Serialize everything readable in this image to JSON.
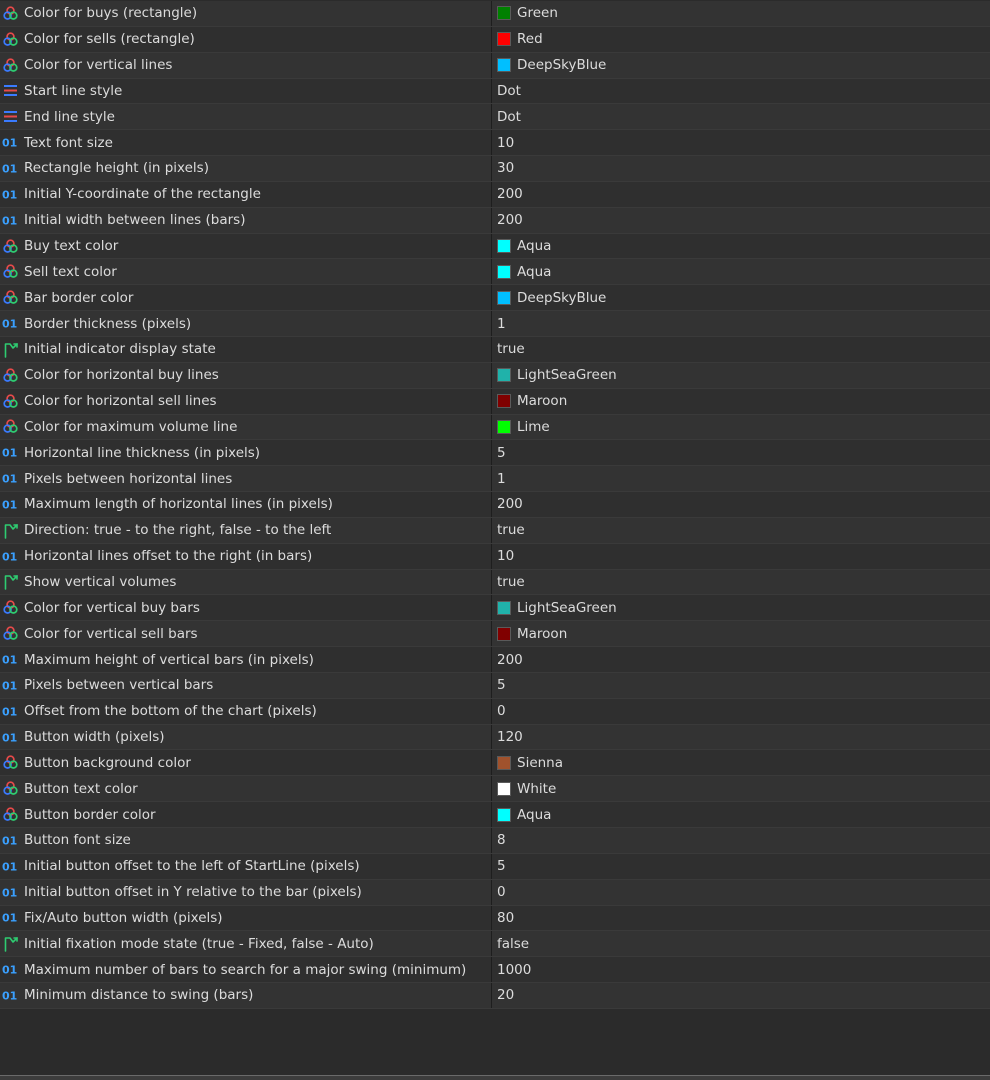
{
  "params": [
    {
      "icon": "color-icon",
      "name": "Color for buys (rectangle)",
      "value": "Green",
      "color": "#008000"
    },
    {
      "icon": "color-icon",
      "name": "Color for sells (rectangle)",
      "value": "Red",
      "color": "#ff0000"
    },
    {
      "icon": "color-icon",
      "name": "Color for vertical lines",
      "value": "DeepSkyBlue",
      "color": "#00bfff"
    },
    {
      "icon": "line-style-icon",
      "name": "Start line style",
      "value": "Dot"
    },
    {
      "icon": "line-style-icon",
      "name": "End line style",
      "value": "Dot"
    },
    {
      "icon": "integer-icon",
      "name": "Text font size",
      "value": "10"
    },
    {
      "icon": "integer-icon",
      "name": "Rectangle height (in pixels)",
      "value": "30"
    },
    {
      "icon": "integer-icon",
      "name": "Initial Y-coordinate of the rectangle",
      "value": "200"
    },
    {
      "icon": "integer-icon",
      "name": "Initial width between lines (bars)",
      "value": "200"
    },
    {
      "icon": "color-icon",
      "name": "Buy text color",
      "value": "Aqua",
      "color": "#00ffff"
    },
    {
      "icon": "color-icon",
      "name": "Sell text color",
      "value": "Aqua",
      "color": "#00ffff"
    },
    {
      "icon": "color-icon",
      "name": "Bar border color",
      "value": "DeepSkyBlue",
      "color": "#00bfff"
    },
    {
      "icon": "integer-icon",
      "name": "Border thickness (pixels)",
      "value": "1"
    },
    {
      "icon": "boolean-icon",
      "name": "Initial indicator display state",
      "value": "true"
    },
    {
      "icon": "color-icon",
      "name": "Color for horizontal buy lines",
      "value": "LightSeaGreen",
      "color": "#20b2aa"
    },
    {
      "icon": "color-icon",
      "name": "Color for horizontal sell lines",
      "value": "Maroon",
      "color": "#800000"
    },
    {
      "icon": "color-icon",
      "name": "Color for maximum volume line",
      "value": "Lime",
      "color": "#00ff00"
    },
    {
      "icon": "integer-icon",
      "name": "Horizontal line thickness (in pixels)",
      "value": "5"
    },
    {
      "icon": "integer-icon",
      "name": "Pixels between horizontal lines",
      "value": "1"
    },
    {
      "icon": "integer-icon",
      "name": "Maximum length of horizontal lines (in pixels)",
      "value": "200"
    },
    {
      "icon": "boolean-icon",
      "name": "Direction: true - to the right, false - to the left",
      "value": "true"
    },
    {
      "icon": "integer-icon",
      "name": "Horizontal lines offset to the right (in bars)",
      "value": "10"
    },
    {
      "icon": "boolean-icon",
      "name": "Show vertical volumes",
      "value": "true"
    },
    {
      "icon": "color-icon",
      "name": "Color for vertical buy bars",
      "value": "LightSeaGreen",
      "color": "#20b2aa"
    },
    {
      "icon": "color-icon",
      "name": "Color for vertical sell bars",
      "value": "Maroon",
      "color": "#800000"
    },
    {
      "icon": "integer-icon",
      "name": "Maximum height of vertical bars (in pixels)",
      "value": "200"
    },
    {
      "icon": "integer-icon",
      "name": "Pixels between vertical bars",
      "value": "5"
    },
    {
      "icon": "integer-icon",
      "name": "Offset from the bottom of the chart (pixels)",
      "value": "0"
    },
    {
      "icon": "integer-icon",
      "name": "Button width (pixels)",
      "value": "120"
    },
    {
      "icon": "color-icon",
      "name": "Button background color",
      "value": "Sienna",
      "color": "#a0522d"
    },
    {
      "icon": "color-icon",
      "name": "Button text color",
      "value": "White",
      "color": "#ffffff"
    },
    {
      "icon": "color-icon",
      "name": "Button border color",
      "value": "Aqua",
      "color": "#00ffff"
    },
    {
      "icon": "integer-icon",
      "name": "Button font size",
      "value": "8"
    },
    {
      "icon": "integer-icon",
      "name": "Initial button offset to the left of StartLine (pixels)",
      "value": "5"
    },
    {
      "icon": "integer-icon",
      "name": "Initial button offset in Y relative to the bar (pixels)",
      "value": "0"
    },
    {
      "icon": "integer-icon",
      "name": "Fix/Auto button width (pixels)",
      "value": "80"
    },
    {
      "icon": "boolean-icon",
      "name": "Initial fixation mode state (true - Fixed, false - Auto)",
      "value": "false"
    },
    {
      "icon": "integer-icon",
      "name": "Maximum number of bars to search for a major swing (minimum)",
      "value": "1000"
    },
    {
      "icon": "integer-icon",
      "name": "Minimum distance to swing (bars)",
      "value": "20"
    }
  ],
  "icon_glyphs": {
    "integer-icon": "01"
  },
  "theme": {
    "integer_icon_color": "#3aa0ff",
    "boolean_icon_color": "#2ecc71",
    "line_style_icon_colors": [
      "#3a7bff",
      "#e84a4a"
    ]
  }
}
